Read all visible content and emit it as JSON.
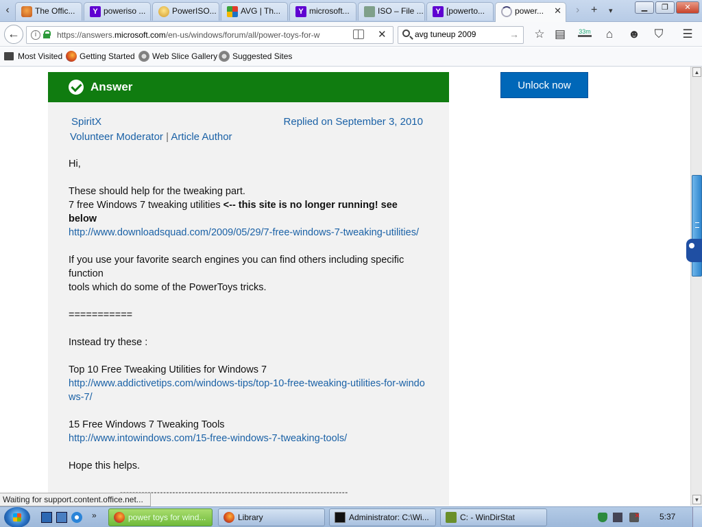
{
  "browser": {
    "tabs": [
      {
        "title": "The Offic...",
        "icon": "office-icon",
        "active": false
      },
      {
        "title": "poweriso ...",
        "icon": "yahoo-icon",
        "active": false
      },
      {
        "title": "PowerISO...",
        "icon": "poweriso-icon",
        "active": false
      },
      {
        "title": "AVG | Th...",
        "icon": "avg-icon",
        "active": false
      },
      {
        "title": "microsoft...",
        "icon": "yahoo-icon",
        "active": false
      },
      {
        "title": "ISO – File ...",
        "icon": "iso-icon",
        "active": false
      },
      {
        "title": "[powerto...",
        "icon": "yahoo-icon",
        "active": false
      },
      {
        "title": "power...",
        "icon": "loading-icon",
        "active": true
      }
    ],
    "url": {
      "prefix": "https://answers.",
      "domain": "microsoft.com",
      "path": "/en-us/windows/forum/all/power-toys-for-w"
    },
    "search": {
      "value": "avg tuneup 2009"
    },
    "downloads_badge": "33m",
    "bookmarks": [
      "Most Visited",
      "Getting Started",
      "Web Slice Gallery",
      "Suggested Sites"
    ],
    "status_text": "Waiting for support.content.office.net..."
  },
  "page": {
    "answer_label": "Answer",
    "unlock_button": "Unlock now",
    "author": "SpiritX",
    "replied": "Replied on September 3, 2010",
    "role_primary": "Volunteer Moderator",
    "role_sep": "|",
    "role_secondary": "Article Author",
    "greeting": "Hi,",
    "intro": "These should help for the tweaking part.",
    "utility_line_plain": "7 free Windows 7 tweaking utilities ",
    "utility_line_bold": "<-- this site is no longer running! see below",
    "link1": "http://www.downloadsquad.com/2009/05/29/7-free-windows-7-tweaking-utilities/",
    "search_para_1": "If you use your favorite search engines you can find others including specific function",
    "search_para_2": "tools which do some of the PowerToys tricks.",
    "separator": "===========",
    "instead": "Instead try these :",
    "item1_title": "Top 10 Free Tweaking Utilities for Windows 7",
    "link2": "http://www.addictivetips.com/windows-tips/top-10-free-tweaking-utilities-for-windows-7/",
    "item2_title": "15 Free Windows 7 Tweaking Tools",
    "link3": "http://www.intowindows.com/15-free-windows-7-tweaking-tools/",
    "closing": "Hope this helps.",
    "dashes": "--------------------------------------------------------------------------"
  },
  "taskbar": {
    "tasks": [
      {
        "label": "power toys for wind...",
        "icon": "firefox-icon",
        "active": true
      },
      {
        "label": "Library",
        "icon": "firefox-icon",
        "active": false
      },
      {
        "label": "Administrator: C:\\Wi...",
        "icon": "cmd-icon",
        "active": false
      },
      {
        "label": "C: - WinDirStat",
        "icon": "windirstat-icon",
        "active": false
      }
    ],
    "clock": "5:37"
  },
  "colors": {
    "answer_green": "#107c10",
    "link_blue": "#1a61a6",
    "button_blue": "#0067b8"
  }
}
